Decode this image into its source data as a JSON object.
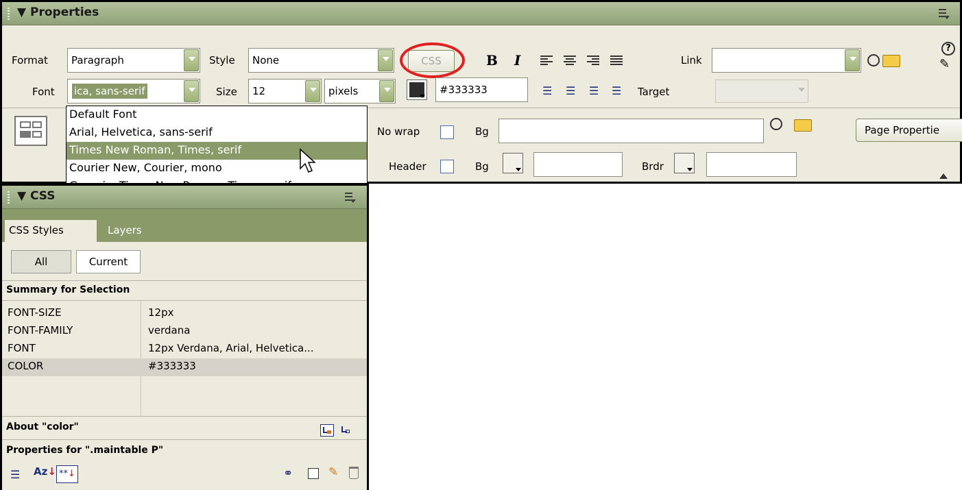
{
  "properties_panel": {
    "title": "Properties",
    "format_label": "Format",
    "format_value": "Paragraph",
    "style_label": "Style",
    "style_value": "None",
    "css_button": "CSS",
    "bold_label": "B",
    "italic_label": "I",
    "link_label": "Link",
    "link_value": "",
    "font_label": "Font",
    "font_value": "ica, sans-serif",
    "size_label": "Size",
    "size_value": "12",
    "unit_value": "pixels",
    "color_value": "#333333",
    "target_label": "Target",
    "target_value": "",
    "no_wrap_label": "No wrap",
    "bg_label": "Bg",
    "bg_value": "",
    "header_label": "Header",
    "bg2_label": "Bg",
    "bg2_value": "",
    "brdr_label": "Brdr",
    "brdr_value": "",
    "page_properties_button": "Page Propertie",
    "help_icon": "help-icon",
    "edit_icon": "edit-icon",
    "font_dropdown_options": [
      "Default Font",
      "Arial, Helvetica, sans-serif",
      "Times New Roman, Times, serif",
      "Courier New, Courier, mono",
      "Georgia, Times New Roman, Times, serif"
    ],
    "font_dropdown_selected_index": 2
  },
  "css_panel": {
    "title": "CSS",
    "tabs": [
      "CSS Styles",
      "Layers"
    ],
    "active_tab": "CSS Styles",
    "mode_buttons": [
      "All",
      "Current"
    ],
    "active_mode": "Current",
    "summary_header": "Summary for Selection",
    "summary_rows": [
      {
        "property": "FONT-SIZE",
        "value": "12px"
      },
      {
        "property": "FONT-FAMILY",
        "value": "verdana"
      },
      {
        "property": "FONT",
        "value": "12px Verdana, Arial, Helvetica..."
      },
      {
        "property": "COLOR",
        "value": "#333333",
        "selected": true
      }
    ],
    "about_header": "About \"color\"",
    "properties_header": "Properties for \".maintable P\""
  },
  "colors": {
    "panel_bg": "#ecebdd",
    "titlebar": "#9fb07f",
    "dropdown_highlight": "#8a9a68",
    "annotation_circle": "#e02020",
    "selected_row": "#d5d3c9"
  }
}
